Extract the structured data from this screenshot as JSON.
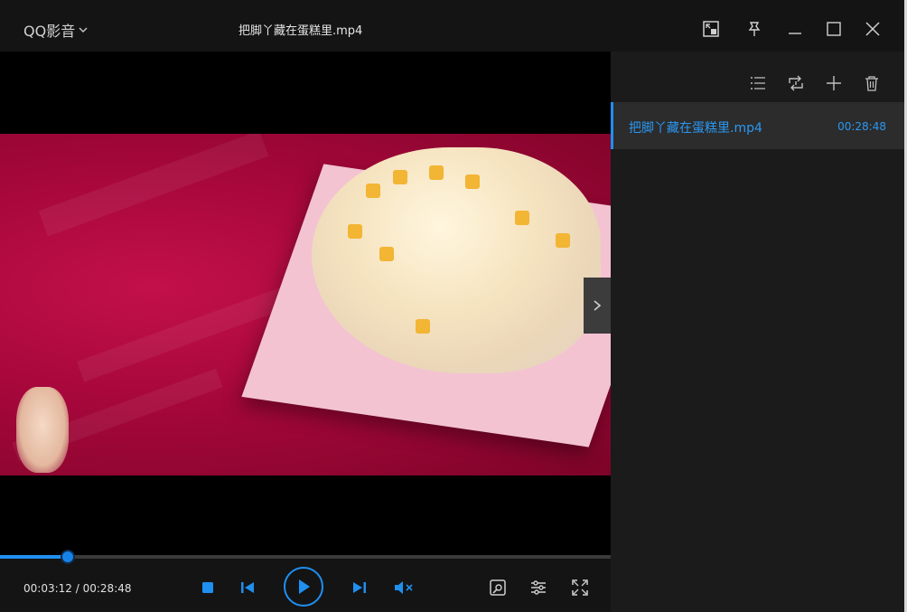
{
  "app": {
    "name": "QQ影音",
    "menu_icon": "chevron-down"
  },
  "window": {
    "title": "把脚丫藏在蛋糕里.mp4",
    "buttons": [
      "mini-mode-icon",
      "pin-icon",
      "minimize-icon",
      "maximize-icon",
      "close-icon"
    ]
  },
  "player": {
    "current_time": "00:03:12",
    "separator": "/",
    "total_time": "00:28:48",
    "progress_fraction": 0.111,
    "muted": true,
    "controls": [
      "stop-icon",
      "previous-icon",
      "play-icon",
      "next-icon",
      "mute-icon",
      "toolbox-icon",
      "settings-icon",
      "fullscreen-icon"
    ]
  },
  "playlist": {
    "tools": [
      "list-icon",
      "loop-icon",
      "add-icon",
      "delete-icon"
    ],
    "items": [
      {
        "name": "把脚丫藏在蛋糕里.mp4",
        "duration": "00:28:48",
        "active": true
      }
    ]
  },
  "colors": {
    "accent": "#1f8ff0",
    "background": "#141414",
    "panel": "#1b1b1b",
    "selected": "#2c2c2c"
  }
}
